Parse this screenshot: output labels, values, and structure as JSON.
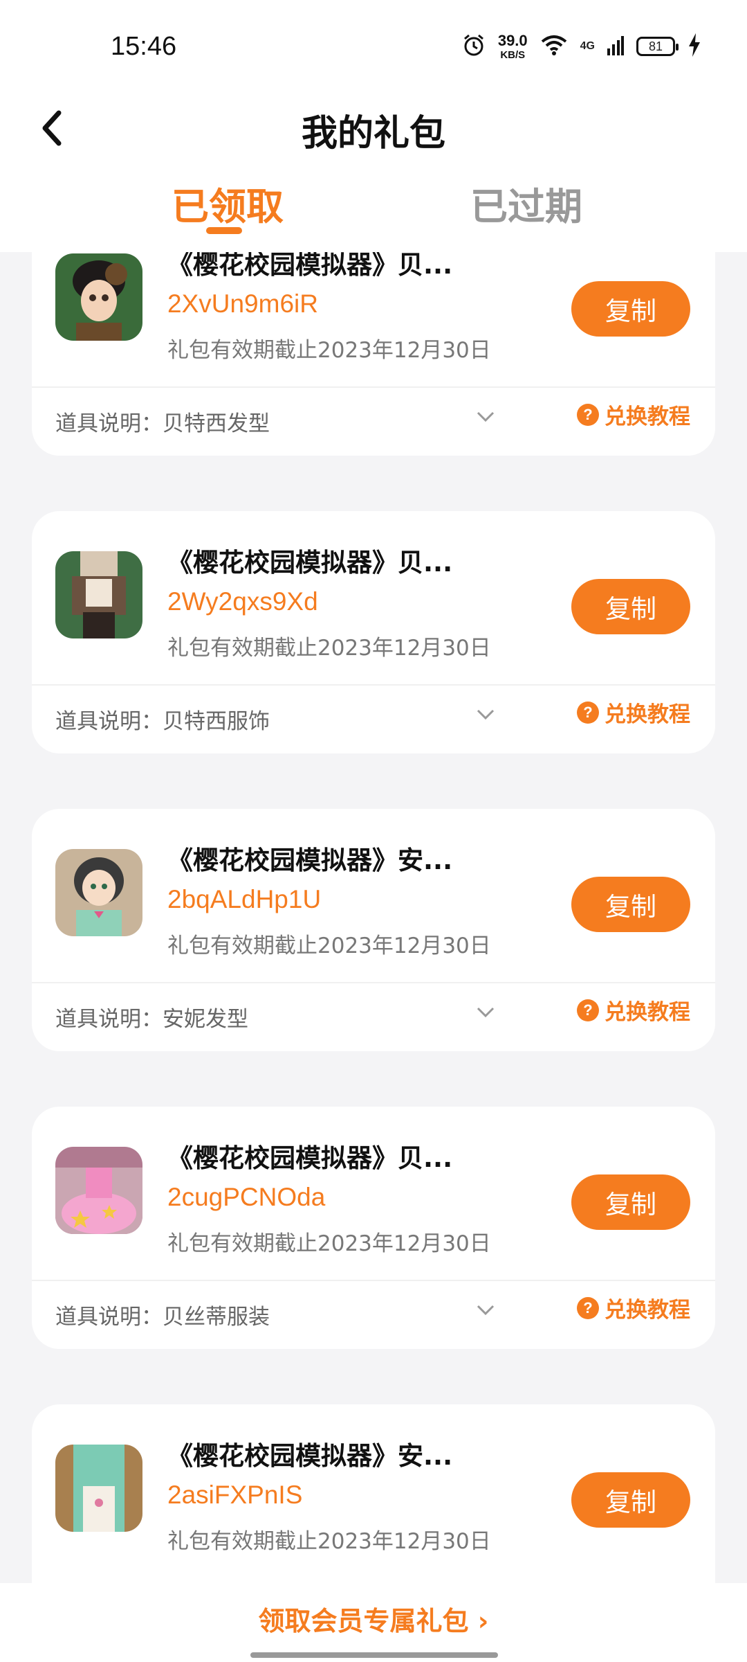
{
  "status_bar": {
    "time": "15:46",
    "net_speed_value": "39.0",
    "net_speed_unit": "KB/S",
    "signal_label": "4G",
    "battery": "81"
  },
  "header": {
    "title": "我的礼包",
    "tabs": [
      {
        "label": "已领取",
        "active": true
      },
      {
        "label": "已过期",
        "active": false
      }
    ]
  },
  "gifts": [
    {
      "title": "《樱花校园模拟器》贝...",
      "code": "2XvUn9m6iR",
      "expiry": "礼包有效期截止2023年12月30日",
      "description": "道具说明：贝特西发型",
      "copy_label": "复制",
      "howto_label": "兑换教程",
      "thumb_colors": [
        "#3a6b3a",
        "#6a4a2a"
      ]
    },
    {
      "title": "《樱花校园模拟器》贝...",
      "code": "2Wy2qxs9Xd",
      "expiry": "礼包有效期截止2023年12月30日",
      "description": "道具说明：贝特西服饰",
      "copy_label": "复制",
      "howto_label": "兑换教程",
      "thumb_colors": [
        "#3f6e44",
        "#6b5240"
      ]
    },
    {
      "title": "《樱花校园模拟器》安...",
      "code": "2bqALdHp1U",
      "expiry": "礼包有效期截止2023年12月30日",
      "description": "道具说明：安妮发型",
      "copy_label": "复制",
      "howto_label": "兑换教程",
      "thumb_colors": [
        "#c8b49a",
        "#8fd1b8"
      ]
    },
    {
      "title": "《樱花校园模拟器》贝...",
      "code": "2cugPCNOda",
      "expiry": "礼包有效期截止2023年12月30日",
      "description": "道具说明：贝丝蒂服装",
      "copy_label": "复制",
      "howto_label": "兑换教程",
      "thumb_colors": [
        "#b07a90",
        "#f4a6cf"
      ]
    },
    {
      "title": "《樱花校园模拟器》安...",
      "code": "2asiFXPnIS",
      "expiry": "礼包有效期截止2023年12月30日",
      "description": "",
      "copy_label": "复制",
      "howto_label": "",
      "thumb_colors": [
        "#a8804f",
        "#7ccbb4"
      ]
    }
  ],
  "footer": {
    "member_link": "领取会员专属礼包 ›"
  },
  "colors": {
    "accent": "#f57c1f",
    "background": "#f4f4f6"
  }
}
